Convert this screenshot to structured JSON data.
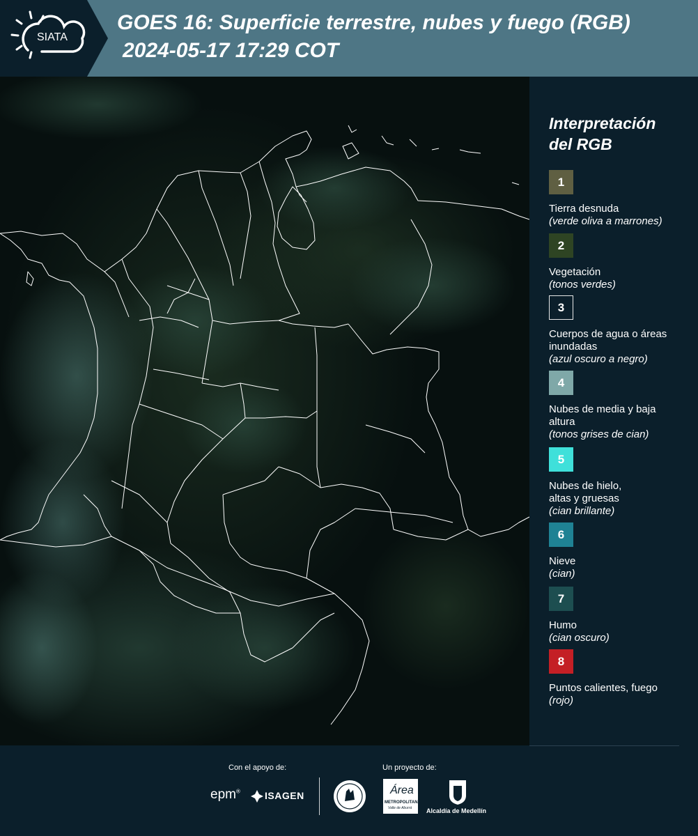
{
  "header": {
    "logo_text": "SIATA",
    "title": "GOES 16: Superficie terrestre, nubes y fuego (RGB)",
    "datetime": "2024-05-17 17:29 COT"
  },
  "map": {
    "background": "#07100f",
    "border_color": "#ffffff"
  },
  "legend": {
    "title_line1": "Interpretación",
    "title_line2": "del RGB",
    "items": [
      {
        "number": "1",
        "color": "#5f5f42",
        "label": "Tierra desnuda",
        "note": "(verde oliva a marrones)"
      },
      {
        "number": "2",
        "color": "#2e4423",
        "label": "Vegetación",
        "note": "(tonos verdes)"
      },
      {
        "number": "3",
        "color": "#0b1f2b",
        "label": "Cuerpos de agua o áreas inundadas",
        "note": "(azul oscuro a negro)"
      },
      {
        "number": "4",
        "color": "#7fa8a8",
        "label": "Nubes de media y baja altura",
        "note": "(tonos grises de cian)"
      },
      {
        "number": "5",
        "color": "#3fe0da",
        "label": "Nubes de hielo, altas y gruesas",
        "note": "(cian brillante)"
      },
      {
        "number": "6",
        "color": "#1f8294",
        "label": "Nieve",
        "note": "(cian)"
      },
      {
        "number": "7",
        "color": "#1d4e50",
        "label": "Humo",
        "note": "(cian oscuro)"
      },
      {
        "number": "8",
        "color": "#c41f25",
        "label": "Puntos calientes, fuego",
        "note": "(rojo)"
      }
    ]
  },
  "footer": {
    "support_label": "Con el apoyo de:",
    "project_label": "Un proyecto de:",
    "epm": "epm",
    "isagen": "ISAGEN",
    "area_line1": "METROPOLITANA",
    "area_line2": "Valle de Aburrá",
    "area_script": "Área",
    "alcaldia": "Alcaldía de Medellín"
  }
}
